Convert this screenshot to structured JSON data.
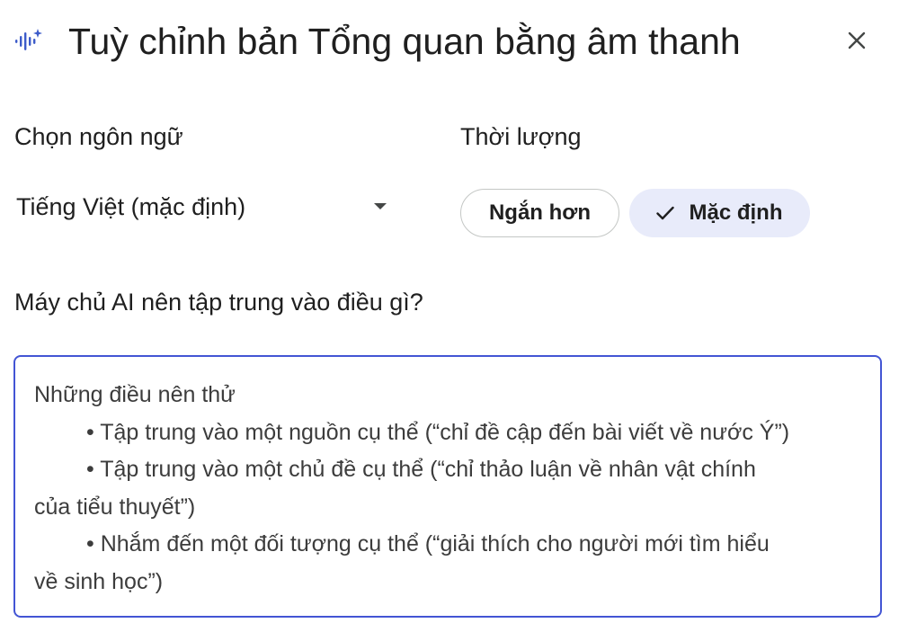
{
  "header": {
    "title": "Tuỳ chỉnh bản Tổng quan bằng âm thanh",
    "icon": "audio-sparkle-icon",
    "close_icon": "close-icon"
  },
  "language": {
    "label": "Chọn ngôn ngữ",
    "selected": "Tiếng Việt (mặc định)"
  },
  "duration": {
    "label": "Thời lượng",
    "options": [
      {
        "label": "Ngắn hơn",
        "selected": false
      },
      {
        "label": "Mặc định",
        "selected": true
      }
    ]
  },
  "focus": {
    "label": "Máy chủ AI nên tập trung vào điều gì?",
    "placeholder_lines": [
      "Những điều nên thử",
      "• Tập trung vào một nguồn cụ thể (“chỉ đề cập đến bài viết về nước Ý”)",
      "• Tập trung vào một chủ đề cụ thể (“chỉ thảo luận về nhân vật chính",
      "của tiểu thuyết”)",
      "• Nhắm đến một đối tượng cụ thể (“giải thích cho người mới tìm hiểu",
      "về sinh học”)"
    ]
  },
  "colors": {
    "focus_border": "#4355d4",
    "selected_chip_bg": "#e8ebfa",
    "icon_blue": "#3c5bc9"
  }
}
